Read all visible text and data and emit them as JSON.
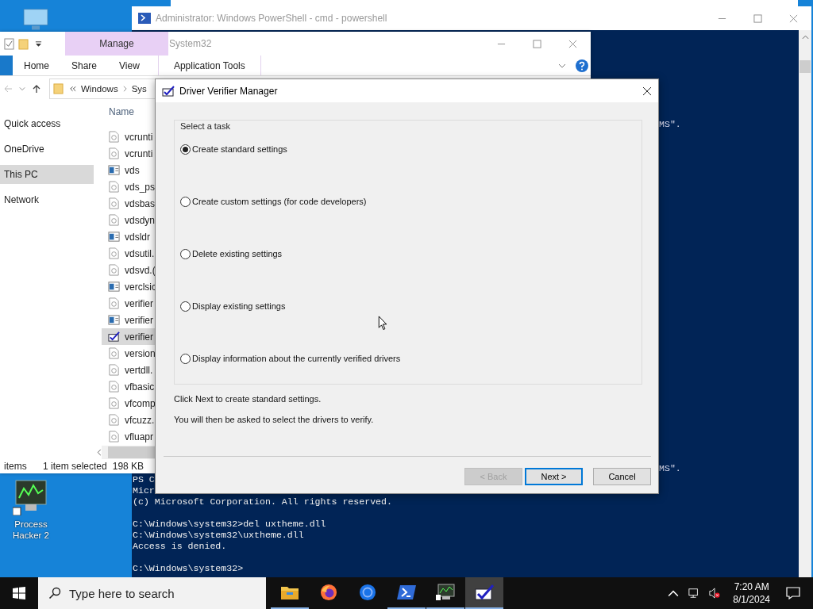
{
  "desktop": {
    "icons": [
      {
        "label": "Process Hacker 2"
      }
    ]
  },
  "powershell": {
    "title": "Administrator: Windows PowerShell - cmd - powershell",
    "fragments": [
      "MS\".",
      "MS\"."
    ],
    "blocks": [
      [
        "PS C",
        "Micr",
        "(c) Microsoft Corporation. All rights reserved."
      ],
      [
        "C:\\Windows\\system32>del uxtheme.dll",
        "C:\\Windows\\system32\\uxtheme.dll",
        "Access is denied."
      ],
      [
        "C:\\Windows\\system32>"
      ]
    ]
  },
  "explorer": {
    "context_tab": "Manage",
    "title": "System32",
    "ribbon_tabs": [
      {
        "label": "Home",
        "selected": false
      },
      {
        "label": "Share",
        "selected": false
      },
      {
        "label": "View",
        "selected": false
      },
      {
        "label": "Application Tools",
        "selected": false
      }
    ],
    "address": [
      "Windows",
      "Sys"
    ],
    "nav": [
      {
        "label": "Quick access",
        "selected": false
      },
      {
        "label": "OneDrive",
        "selected": false
      },
      {
        "label": "This PC",
        "selected": true
      },
      {
        "label": "Network",
        "selected": false
      }
    ],
    "column": "Name",
    "files": [
      {
        "name": "vcrunti",
        "kind": "dll",
        "selected": false
      },
      {
        "name": "vcrunti",
        "kind": "dll",
        "selected": false
      },
      {
        "name": "vds",
        "kind": "app",
        "selected": false
      },
      {
        "name": "vds_ps",
        "kind": "dll",
        "selected": false
      },
      {
        "name": "vdsbas",
        "kind": "dll",
        "selected": false
      },
      {
        "name": "vdsdyn",
        "kind": "dll",
        "selected": false
      },
      {
        "name": "vdsldr",
        "kind": "app",
        "selected": false
      },
      {
        "name": "vdsutil.",
        "kind": "dll",
        "selected": false
      },
      {
        "name": "vdsvd.(",
        "kind": "dll",
        "selected": false
      },
      {
        "name": "verclsic",
        "kind": "app",
        "selected": false
      },
      {
        "name": "verifier",
        "kind": "dll",
        "selected": false
      },
      {
        "name": "verifier",
        "kind": "app",
        "selected": false
      },
      {
        "name": "verifier",
        "kind": "verifier",
        "selected": true
      },
      {
        "name": "version",
        "kind": "dll",
        "selected": false
      },
      {
        "name": "vertdll.",
        "kind": "dll",
        "selected": false
      },
      {
        "name": "vfbasic",
        "kind": "dll",
        "selected": false
      },
      {
        "name": "vfcomp",
        "kind": "dll",
        "selected": false
      },
      {
        "name": "vfcuzz.",
        "kind": "dll",
        "selected": false
      },
      {
        "name": "vfluapr",
        "kind": "dll",
        "selected": false
      }
    ],
    "status": {
      "count": "items",
      "selection": "1 item selected",
      "size": "198 KB"
    }
  },
  "dialog": {
    "title": "Driver Verifier Manager",
    "group_label": "Select a task",
    "options": [
      {
        "label": "Create standard settings",
        "selected": true
      },
      {
        "label": "Create custom settings (for code developers)",
        "selected": false
      },
      {
        "label": "Delete existing settings",
        "selected": false
      },
      {
        "label": "Display existing settings",
        "selected": false
      },
      {
        "label": "Display information about the currently verified drivers",
        "selected": false
      }
    ],
    "info": [
      "Click Next to create standard settings.",
      "You will then be asked to select the drivers to verify."
    ],
    "buttons": [
      {
        "label": "< Back",
        "disabled": true,
        "default": false
      },
      {
        "label": "Next >",
        "disabled": false,
        "default": true
      },
      {
        "label": "Cancel",
        "disabled": false,
        "default": false
      }
    ]
  },
  "taskbar": {
    "search_placeholder": "Type here to search",
    "apps": [
      {
        "kind": "folder",
        "running": true,
        "active": false
      },
      {
        "kind": "firefox",
        "running": false,
        "active": false
      },
      {
        "kind": "browser",
        "running": false,
        "active": false
      },
      {
        "kind": "powershell",
        "running": true,
        "active": false
      },
      {
        "kind": "monitor",
        "running": true,
        "active": false
      },
      {
        "kind": "verifier",
        "running": true,
        "active": true
      }
    ],
    "time": "7:20 AM",
    "date": "8/1/2024"
  }
}
